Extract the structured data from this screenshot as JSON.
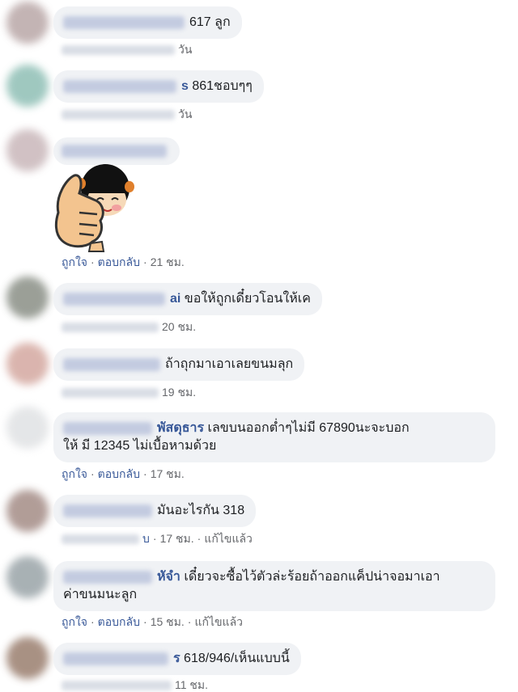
{
  "comments": [
    {
      "text": "617 ลูก",
      "time": "วัน"
    },
    {
      "name_suffix": "s",
      "text": "861ชอบๆๆ",
      "time": "วัน"
    },
    {
      "like": "ถูกใจ",
      "reply": "ตอบกลับ",
      "time": "21 ชม."
    },
    {
      "name_suffix": "ai",
      "text": "ขอให้ถูกเดี๋ยวโอนให้เค",
      "time": "20 ชม."
    },
    {
      "text": "ถ้าถุกมาเอาเลยขนมลุก",
      "time": "19 ชม."
    },
    {
      "name_suffix": "พัสดุธาร",
      "text_line1": "เลขบนออกต่ำๆไม่มี 67890นะจะบอก",
      "text_line2": "ให้ มี 12345 ไม่เบื้อหามด้วย",
      "like": "ถูกใจ",
      "reply": "ตอบกลับ",
      "time": "17 ชม."
    },
    {
      "text": "มันอะไรกัน 318",
      "reply_frag": "บ",
      "time": "17 ชม.",
      "edited": "แก้ไขแล้ว"
    },
    {
      "name_suffix": "หัจำ",
      "text_line1": "เดี๋ยวจะซื้อไว้ตัวล่ะร้อยถ้าออกแค็ปน่าจอมาเอา",
      "text_line2": "ค่าขนมนะลูก",
      "like": "ถูกใจ",
      "reply": "ตอบกลับ",
      "time": "15 ชม.",
      "edited": "แก้ไขแล้ว"
    },
    {
      "name_suffix": "ร",
      "text": "618/946/เห็นแบบนี้",
      "time": "11 ชม."
    }
  ],
  "colors": {
    "name_link": "#385898",
    "bubble_bg": "#f0f2f5",
    "meta_text": "#65676b"
  },
  "sticker_icon": "thumbs-up-girl-sticker"
}
